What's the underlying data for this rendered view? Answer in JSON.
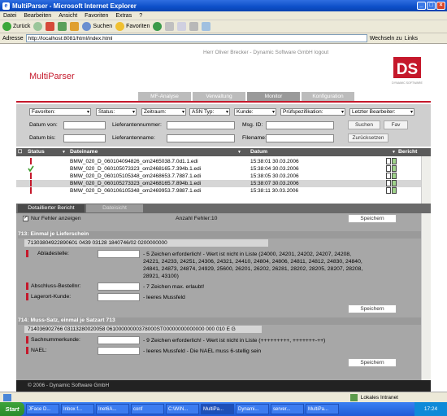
{
  "window": {
    "title": "MultiParser - Microsoft Internet Explorer"
  },
  "menu": [
    "Datei",
    "Bearbeiten",
    "Ansicht",
    "Favoriten",
    "Extras",
    "?"
  ],
  "toolbar": {
    "back": "Zurück",
    "search": "Suchen",
    "favorites": "Favoriten"
  },
  "address": {
    "label": "Adresse",
    "url": "http://localhost:8081/html/index.html",
    "go": "Wechseln zu",
    "links": "Links"
  },
  "header": {
    "user_line": "Herr Oliver Brecker - Dynamic Software GmbH   logout",
    "app_name": "MultiParser",
    "logo_text": "DS",
    "logo_sub": "DYNAMIC SOFTWARE"
  },
  "tabs": [
    "MF-Analyse",
    "Verwaltung",
    "Monitor",
    "Konfiguration"
  ],
  "filters": {
    "selects": [
      "Favoriten:",
      "Status:",
      "Zeitraum:",
      "ASN Typ:",
      "Kunde:",
      "Prüfspezifikation:",
      "Letzter Bearbeiter:"
    ],
    "datum_von": "Datum von:",
    "datum_bis": "Datum bis:",
    "lieferantennummer": "Lieferantennummer:",
    "lieferantenname": "Lieferantenname:",
    "msg_id": "Msg. ID:",
    "filename": "Filename:",
    "search_btn": "Suchen",
    "fav_btn": "Fav",
    "reset_btn": "Zurücksetzen"
  },
  "list": {
    "headers": {
      "status": "Status",
      "dateiname": "Dateiname",
      "datum": "Datum",
      "bericht": "Bericht"
    },
    "rows": [
      {
        "status": "error",
        "file": "BMW_020_D_060104094826_om2465038.7.0d1.1.edi",
        "date": "15:38:01 30.03.2006"
      },
      {
        "status": "ok",
        "file": "BMW_020_D_060105073323_om2468165.7.394b.1.edi",
        "date": "15:38:04 30.03.2006"
      },
      {
        "status": "error",
        "file": "BMW_020_D_060105105348_om2468653.7.7887.1.edi",
        "date": "15:38:05 30.03.2006"
      },
      {
        "status": "error",
        "file": "BMW_020_D_060105273323_om2468165.7.894b.1.edi",
        "date": "15:38:07 30.03.2006"
      },
      {
        "status": "error",
        "file": "BMW_020_D_060106105348_om2469953.7.9887.1.edi",
        "date": "15:38:11 30.03.2006"
      }
    ]
  },
  "detail": {
    "tabs": [
      "Detaillierter Bericht",
      "Dateisicht"
    ],
    "only_errors": "Nur Fehler anzeigen",
    "count_label": "Anzahl Fehler:10",
    "save": "Speichern",
    "sections": [
      {
        "title": "713: Einmal je Lieferschein",
        "code": "71303804922890601 0439 03128 1840746/02 0200000000",
        "fields": [
          {
            "label": "Abladestelle:",
            "lines": [
              "- 5 Zeichen erforderlich! - Wert ist nicht in Liste (24000, 24201, 24202, 24207, 24208,",
              "24221, 24233, 24251, 24306, 24321, 24410, 24804, 24806, 24811, 24812, 24830, 24840,",
              "24841, 24873, 24874, 24929, 25600, 26201, 26202, 26281, 28202, 28205, 28207, 28208,",
              "28921, 43100)"
            ]
          },
          {
            "label": "Abschluss-Bestellnr:",
            "lines": [
              "- 7 Zeichen max. erlaubt!"
            ]
          },
          {
            "label": "Lagerort-Kunde:",
            "lines": [
              "- leeres Mussfeld"
            ]
          }
        ]
      },
      {
        "title": "714: Muss-Satz, einmal je Satzart 713",
        "code": "714036902766 03113280020058 06100000000378000ST00000000000000 000 010 E G",
        "fields": [
          {
            "label": "Sachnummerkunde:",
            "lines": [
              "- 9 Zeichen erforderlich! - Wert ist nicht in Liste (+++++++++, +++++++-++)"
            ]
          },
          {
            "label": "NAEL:",
            "lines": [
              "- leeres Mussfeld - Die NAEL muss 6-stellig sein"
            ]
          }
        ]
      }
    ]
  },
  "footer": "© 2006 - Dynamic Software GmbH",
  "statusbar": {
    "text": "Lokales Intranet"
  },
  "taskbar": {
    "start": "Start",
    "tasks": [
      "JFace D...",
      "Inbox f...",
      "Inet6A...",
      "conf",
      "C:\\WIN...",
      "MultiPa...",
      "Dynami...",
      "server...",
      "MultiPa..."
    ],
    "clock": "17:24"
  },
  "colors": {
    "accent": "#c5182b",
    "error": "#c5182b",
    "ok": "#3a9a2a"
  }
}
